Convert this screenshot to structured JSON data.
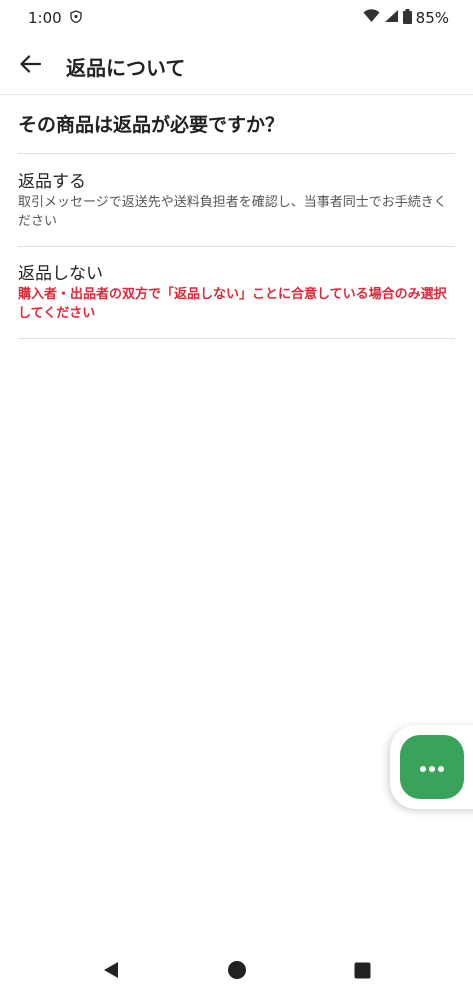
{
  "status": {
    "time": "1:00",
    "battery": "85%",
    "icons": [
      "shield-icon",
      "wifi-icon",
      "signal-icon",
      "battery-icon"
    ]
  },
  "header": {
    "title": "返品について",
    "back_icon": "arrow-left-icon"
  },
  "question": "その商品は返品が必要ですか？",
  "options": [
    {
      "title": "返品する",
      "description": "取引メッセージで返送先や送料負担者を確認し、当事者同士でお手続きください"
    },
    {
      "title": "返品しない",
      "description": "購入者・出品者の双方で「返品しない」ことに合意している場合のみ選択してください",
      "description_color": "#e0293a"
    }
  ],
  "fab": {
    "icon": "more-dots-icon",
    "color": "#3aa35a"
  },
  "nav": {
    "icons": [
      "nav-back-icon",
      "nav-home-icon",
      "nav-recents-icon"
    ]
  }
}
